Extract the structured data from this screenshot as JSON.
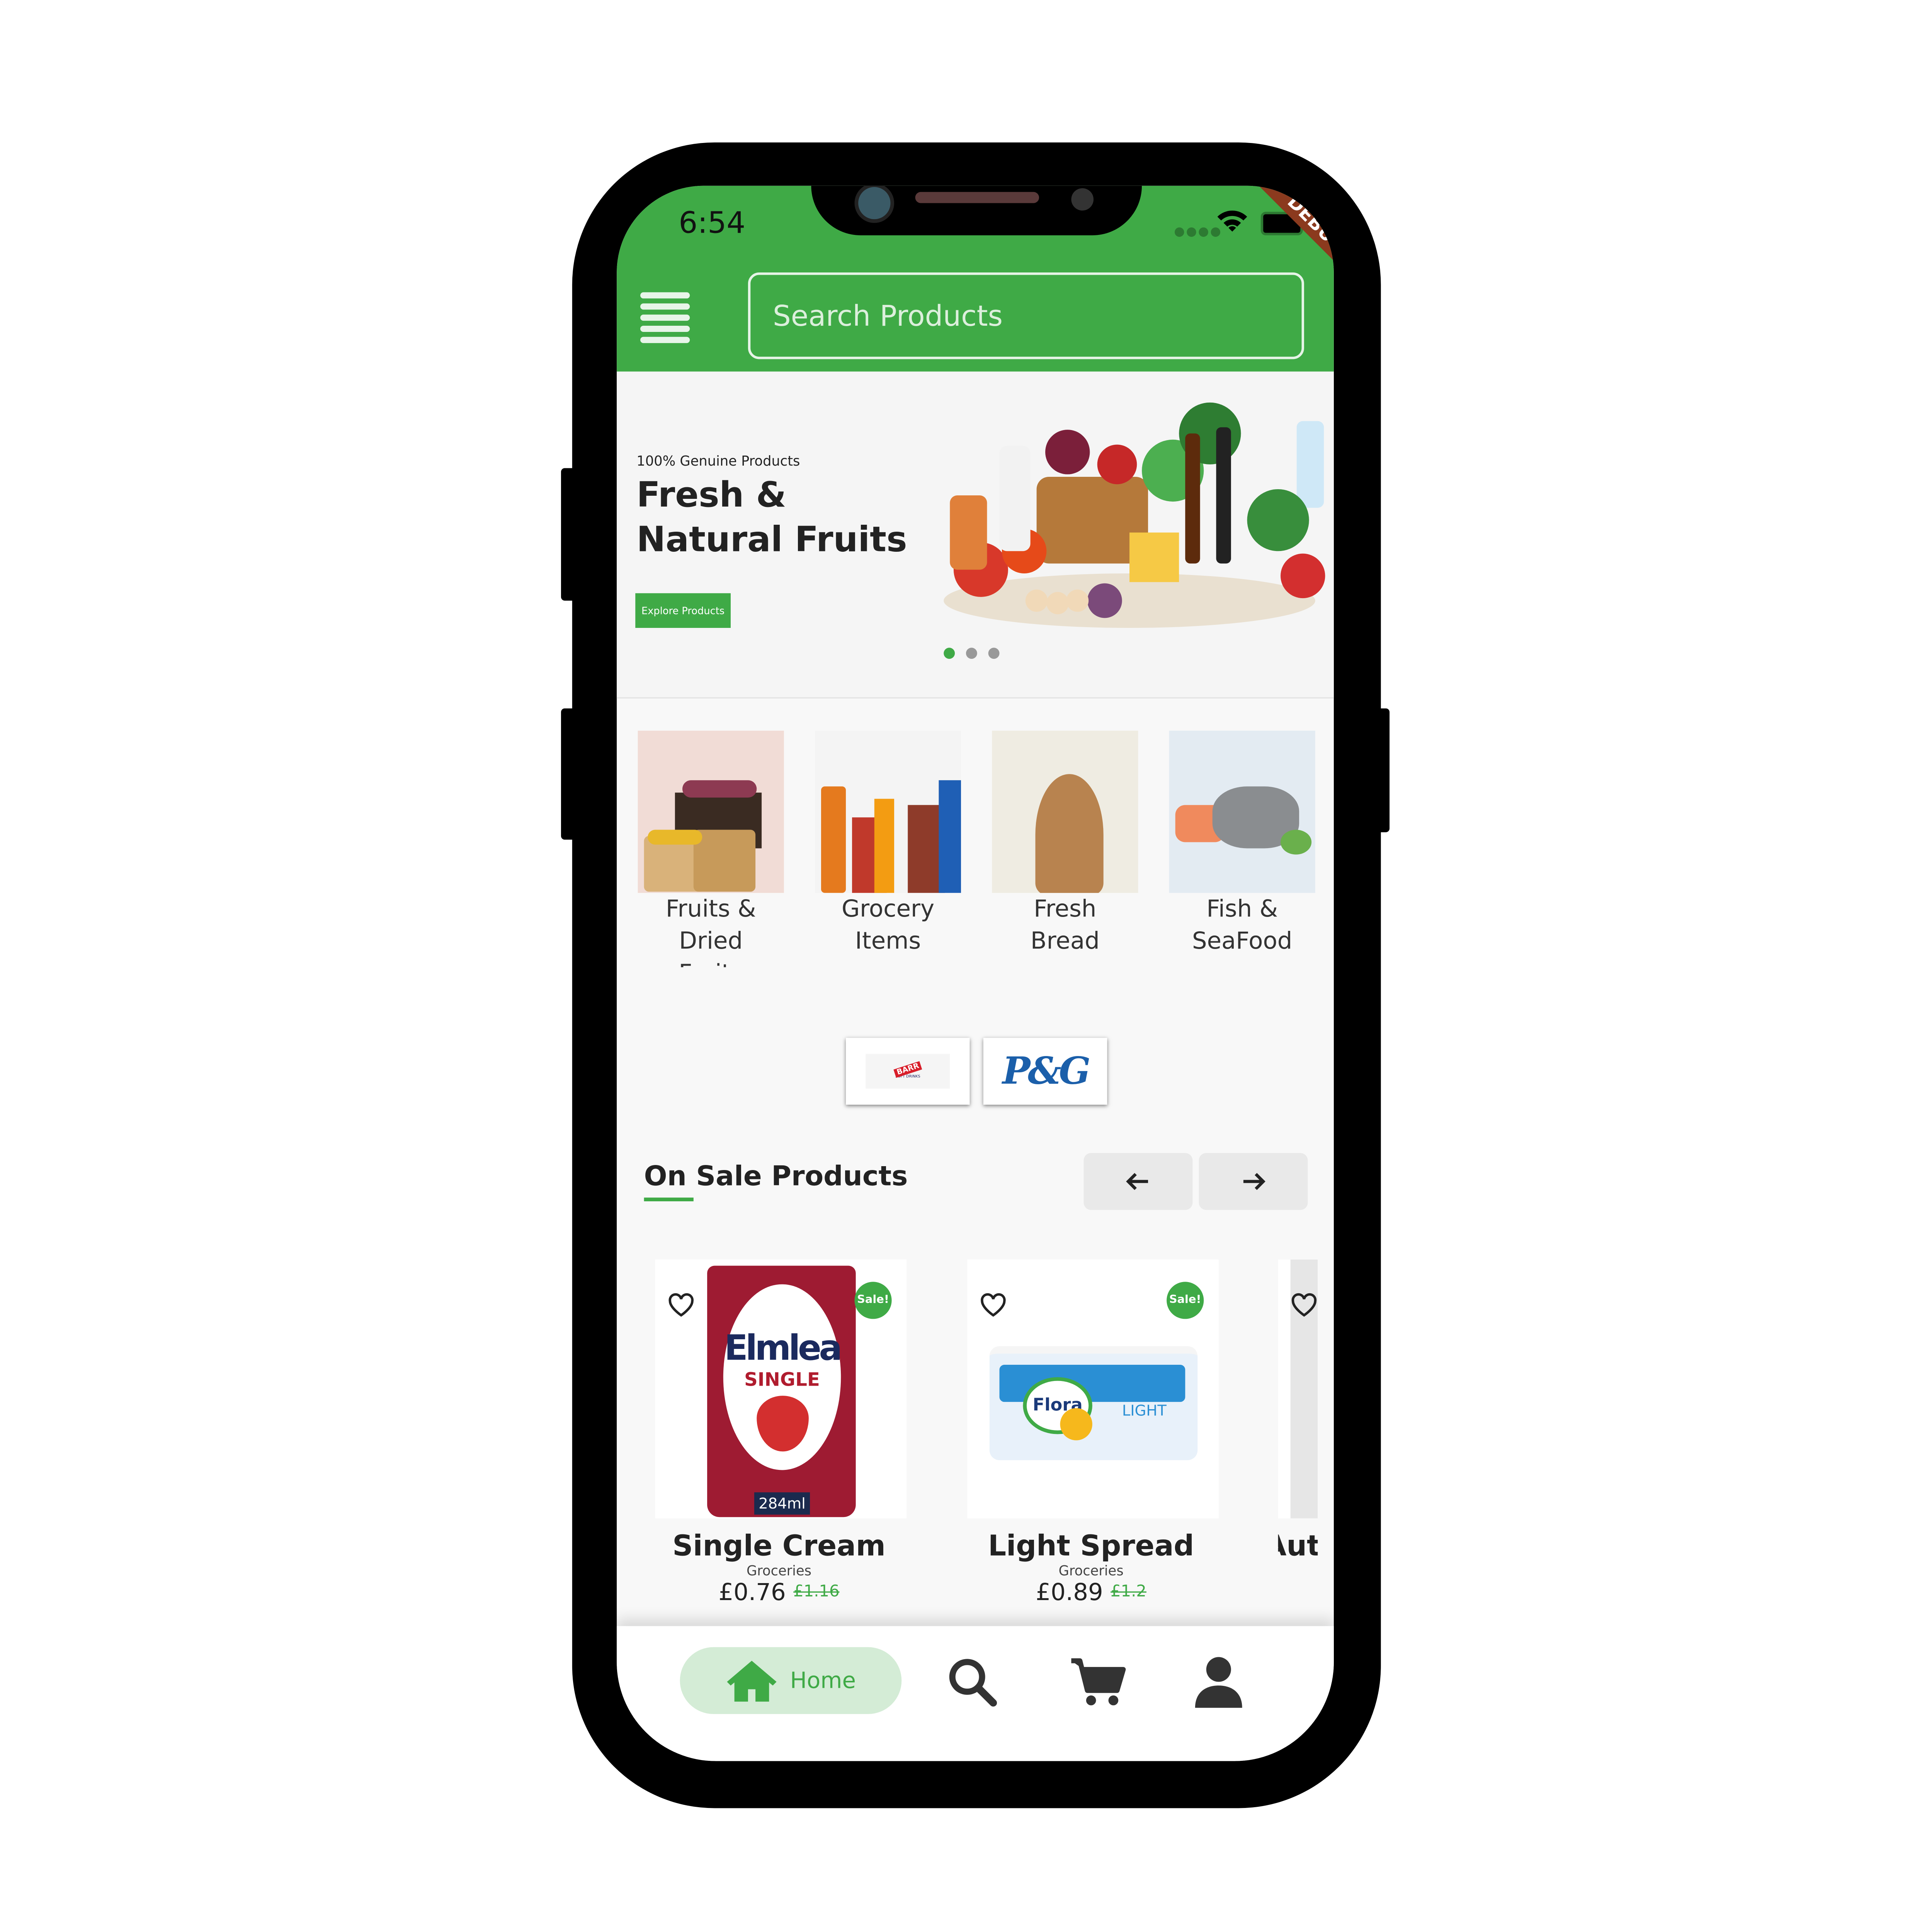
{
  "status_bar": {
    "time": "6:54",
    "debug_banner": "DEBUG"
  },
  "header": {
    "search_placeholder": "Search Products"
  },
  "banner": {
    "kicker": "100% Genuine Products",
    "title_line1": "Fresh &",
    "title_line2": "Natural Fruits",
    "button": "Explore Products",
    "slides": 3,
    "active_slide": 1
  },
  "categories": [
    {
      "label_line1": "Fruits &",
      "label_line2": "Dried",
      "label_line3": "Fruits"
    },
    {
      "label_line1": "Grocery",
      "label_line2": "Items"
    },
    {
      "label_line1": "Fresh",
      "label_line2": "Bread"
    },
    {
      "label_line1": "Fish &",
      "label_line2": "SeaFood"
    }
  ],
  "brands": [
    {
      "name": "BARR",
      "sub": "SOFT DRINKS"
    },
    {
      "name": "P&G"
    }
  ],
  "on_sale": {
    "title": "On Sale Products",
    "prev_icon": "arrow-left-icon",
    "next_icon": "arrow-right-icon",
    "products": [
      {
        "name": "Single Cream",
        "category": "Groceries",
        "price": "£0.76",
        "old_price": "£1.16",
        "badge": "Sale!",
        "image_text": "Elmlea",
        "image_sub": "SINGLE",
        "volume": "284ml"
      },
      {
        "name": "Light Spread",
        "category": "Groceries",
        "price": "£0.89",
        "old_price": "£1.2",
        "badge": "Sale!",
        "image_text": "Flora",
        "image_sub": "LIGHT"
      },
      {
        "name": "Aut"
      }
    ]
  },
  "bottom_nav": {
    "home": "Home",
    "items": [
      "home-icon",
      "search-icon",
      "cart-icon",
      "profile-icon"
    ]
  },
  "colors": {
    "brand_green": "#3faa46",
    "home_pill": "#d4ecd6",
    "debug_ribbon": "#8b3a1e"
  }
}
